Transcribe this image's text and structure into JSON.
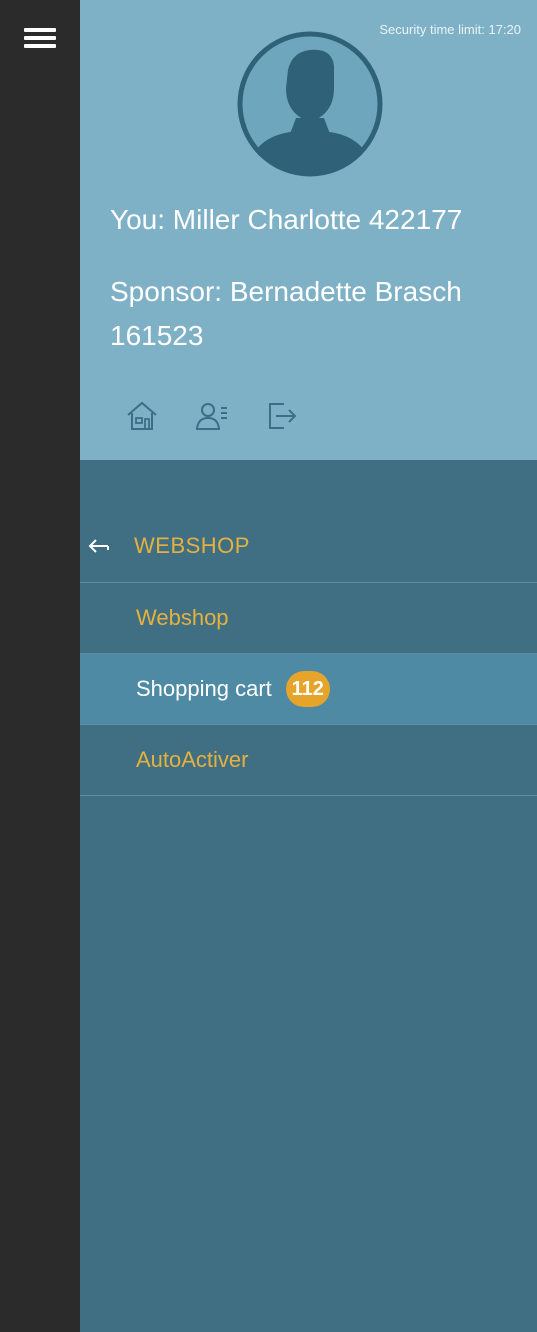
{
  "header": {
    "security_time_limit": "Security time limit: 17:20"
  },
  "profile": {
    "you": "You: Miller Charlotte 422177",
    "sponsor": "Sponsor: Bernadette Brasch 161523",
    "quick_icons": [
      "home-icon",
      "contacts-icon",
      "logout-icon"
    ]
  },
  "menu": {
    "section_label": "WEBSHOP",
    "items": [
      {
        "label": "Webshop",
        "active": false
      },
      {
        "label": "Shopping cart",
        "active": true,
        "badge": "112"
      },
      {
        "label": "AutoActiver",
        "active": false
      }
    ]
  },
  "colors": {
    "rail": "#2b2b2b",
    "profile_bg": "#7fb1c6",
    "panel_bg": "#406f84",
    "active_bg": "#4f8aa4",
    "accent_text": "#e5b13e",
    "badge_bg": "#e6a42b"
  }
}
